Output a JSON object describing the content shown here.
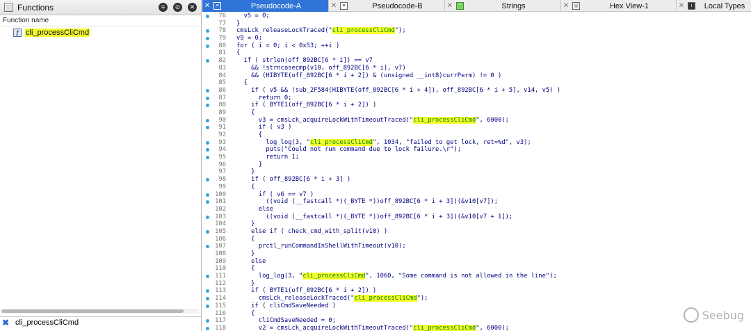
{
  "functions_panel": {
    "title": "Functions",
    "column_header": "Function name",
    "items": [
      {
        "name": "cli_processCliCmd"
      }
    ],
    "search_value": "cli_processCliCmd"
  },
  "tabs": [
    {
      "label": "Pseudocode-A",
      "active": true,
      "icon": "pseudocode-icon"
    },
    {
      "label": "Pseudocode-B",
      "active": false,
      "icon": "pseudocode-icon"
    },
    {
      "label": "Strings",
      "active": false,
      "icon": "strings-icon"
    },
    {
      "label": "Hex View-1",
      "active": false,
      "icon": "hex-icon"
    },
    {
      "label": "Local Types",
      "active": false,
      "icon": "types-icon"
    }
  ],
  "code_lines": [
    {
      "n": "76",
      "bp": true,
      "text": "  v5 = 0;"
    },
    {
      "n": "77",
      "bp": false,
      "text": "}"
    },
    {
      "n": "78",
      "bp": true,
      "text": "cmsLck_releaseLockTraced(\"",
      "hl": "cli_processCliCmd",
      "post": "\");"
    },
    {
      "n": "79",
      "bp": true,
      "text": "v9 = 0;"
    },
    {
      "n": "80",
      "bp": true,
      "text": "for ( i = 0; i < 0x53; ++i )"
    },
    {
      "n": "81",
      "bp": false,
      "text": "{"
    },
    {
      "n": "82",
      "bp": true,
      "text": "  if ( strlen(off_892BC[6 * i]) == v7"
    },
    {
      "n": "83",
      "bp": false,
      "text": "    && !strncasecmp(v10, off_892BC[6 * i], v7)"
    },
    {
      "n": "84",
      "bp": false,
      "text": "    && (HIBYTE(off_892BC[6 * i + 2]) & (unsigned __int8)currPerm) != 0 )"
    },
    {
      "n": "85",
      "bp": false,
      "text": "  {"
    },
    {
      "n": "86",
      "bp": true,
      "text": "    if ( v5 && !sub_2F584(HIBYTE(off_892BC[6 * i + 4]), off_892BC[6 * i + 5], v14, v5) )"
    },
    {
      "n": "87",
      "bp": true,
      "text": "      return 0;"
    },
    {
      "n": "88",
      "bp": true,
      "text": "    if ( BYTE1(off_892BC[6 * i + 2]) )"
    },
    {
      "n": "89",
      "bp": false,
      "text": "    {"
    },
    {
      "n": "90",
      "bp": true,
      "text": "      v3 = cmsLck_acquireLockWithTimeoutTraced(\"",
      "hl": "cli_processCliCmd",
      "post": "\", 6000);"
    },
    {
      "n": "91",
      "bp": true,
      "text": "      if ( v3 )"
    },
    {
      "n": "92",
      "bp": false,
      "text": "      {"
    },
    {
      "n": "93",
      "bp": true,
      "text": "        log_log(3, \"",
      "hl": "cli_processCliCmd",
      "post": "\", 1034, \"failed to get lock, ret=%d\", v3);"
    },
    {
      "n": "94",
      "bp": true,
      "text": "        puts(\"Could not run command due to lock failure.\\r\");"
    },
    {
      "n": "95",
      "bp": true,
      "text": "        return 1;"
    },
    {
      "n": "96",
      "bp": false,
      "text": "      }"
    },
    {
      "n": "97",
      "bp": false,
      "text": "    }"
    },
    {
      "n": "98",
      "bp": true,
      "text": "    if ( off_892BC[6 * i + 3] )"
    },
    {
      "n": "99",
      "bp": false,
      "text": "    {"
    },
    {
      "n": "100",
      "bp": true,
      "text": "      if ( v6 == v7 )"
    },
    {
      "n": "101",
      "bp": true,
      "text": "        ((void (__fastcall *)(_BYTE *))off_892BC[6 * i + 3])(&v10[v7]);"
    },
    {
      "n": "102",
      "bp": false,
      "text": "      else"
    },
    {
      "n": "103",
      "bp": true,
      "text": "        ((void (__fastcall *)(_BYTE *))off_892BC[6 * i + 3])(&v10[v7 + 1]);"
    },
    {
      "n": "104",
      "bp": false,
      "text": "    }"
    },
    {
      "n": "105",
      "bp": true,
      "text": "    else if ( check_cmd_with_split(v10) )"
    },
    {
      "n": "106",
      "bp": false,
      "text": "    {"
    },
    {
      "n": "107",
      "bp": true,
      "text": "      prctl_runCommandInShellWithTimeout(v10);"
    },
    {
      "n": "108",
      "bp": false,
      "text": "    }"
    },
    {
      "n": "109",
      "bp": false,
      "text": "    else"
    },
    {
      "n": "110",
      "bp": false,
      "text": "    {"
    },
    {
      "n": "111",
      "bp": true,
      "text": "      log_log(3, \"",
      "hl": "cli_processCliCmd",
      "post": "\", 1060, \"Some command is not allowed in the line\");"
    },
    {
      "n": "112",
      "bp": false,
      "text": "    }"
    },
    {
      "n": "113",
      "bp": true,
      "text": "    if ( BYTE1(off_892BC[6 * i + 2]) )"
    },
    {
      "n": "114",
      "bp": true,
      "text": "      cmsLck_releaseLockTraced(\"",
      "hl": "cli_processCliCmd",
      "post": "\");"
    },
    {
      "n": "115",
      "bp": true,
      "text": "    if ( cliCmdSaveNeeded )"
    },
    {
      "n": "116",
      "bp": false,
      "text": "    {"
    },
    {
      "n": "117",
      "bp": true,
      "text": "      cliCmdSaveNeeded = 0;"
    },
    {
      "n": "118",
      "bp": true,
      "text": "      v2 = cmsLck_acquireLockWithTimeoutTraced(\"",
      "hl": "cli_processCliCmd",
      "post": "\", 6000);"
    }
  ],
  "watermark": {
    "text": "Seebug"
  }
}
